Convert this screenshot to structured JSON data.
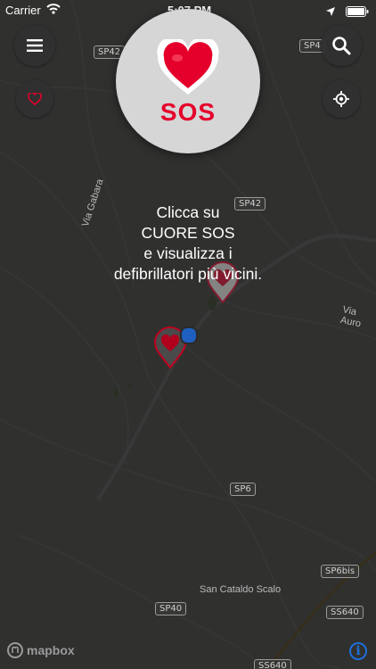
{
  "status_bar": {
    "carrier": "Carrier",
    "time": "5:07 PM"
  },
  "sos": {
    "label": "SOS",
    "heart_color": "#e4002b"
  },
  "hint": {
    "lines": [
      "Clicca su",
      "CUORE SOS",
      "e visualizza i",
      "defibrillatori più vicini."
    ]
  },
  "map": {
    "road_labels": [
      "SP42",
      "SP4",
      "SP42",
      "SP6",
      "SP40",
      "SP6bis",
      "SS640",
      "SS640"
    ],
    "place_labels": [
      "Via Gabara",
      "Via Auro",
      "San Cataldo Scalo"
    ],
    "attribution": "mapbox"
  },
  "buttons": {
    "menu_icon": "hamburger-icon",
    "search_icon": "search-icon",
    "favorite_icon": "heart-outline-icon",
    "locate_icon": "crosshair-icon",
    "info_icon": "info-icon"
  },
  "colors": {
    "accent_red": "#e4002b",
    "user_location": "#1e5fbf",
    "info_blue": "#1e6fd9"
  }
}
